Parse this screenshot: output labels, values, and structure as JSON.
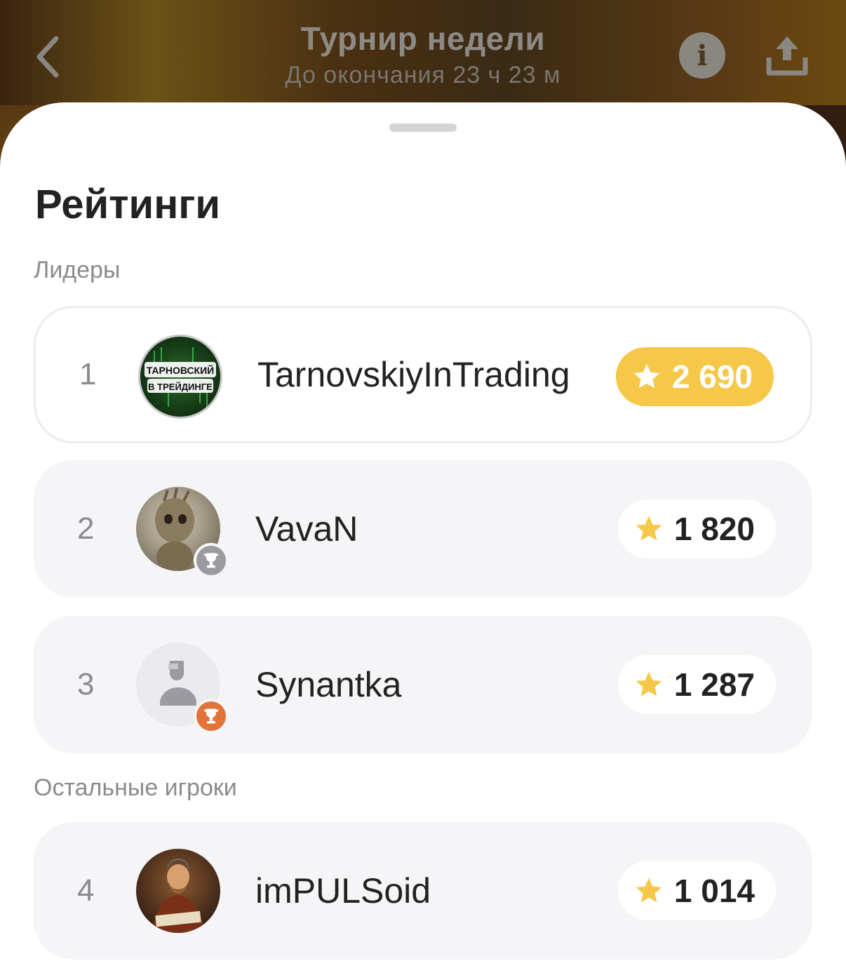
{
  "header": {
    "title": "Турнир недели",
    "subtitle": "До окончания 23 ч 23 м",
    "back_icon": "chevron-left-icon",
    "info_icon": "info-icon",
    "share_icon": "share-icon"
  },
  "sheet": {
    "title": "Рейтинги",
    "leaders_label": "Лидеры",
    "others_label": "Остальные игроки"
  },
  "players": [
    {
      "rank": "1",
      "name": "TarnovskiyInTrading",
      "score": "2 690",
      "avatar_text_1": "ТАРНОВСКИЙ",
      "avatar_text_2": "В ТРЕЙДИНГЕ"
    },
    {
      "rank": "2",
      "name": "VavaN",
      "score": "1 820",
      "badge": "silver-trophy-icon"
    },
    {
      "rank": "3",
      "name": "Synantka",
      "score": "1 287",
      "badge": "bronze-trophy-icon"
    },
    {
      "rank": "4",
      "name": "imPULSoid",
      "score": "1 014"
    }
  ],
  "colors": {
    "gold": "#f6c849",
    "silver": "#9a9aa0",
    "bronze": "#e2733a",
    "row_bg": "#f5f5f7"
  }
}
